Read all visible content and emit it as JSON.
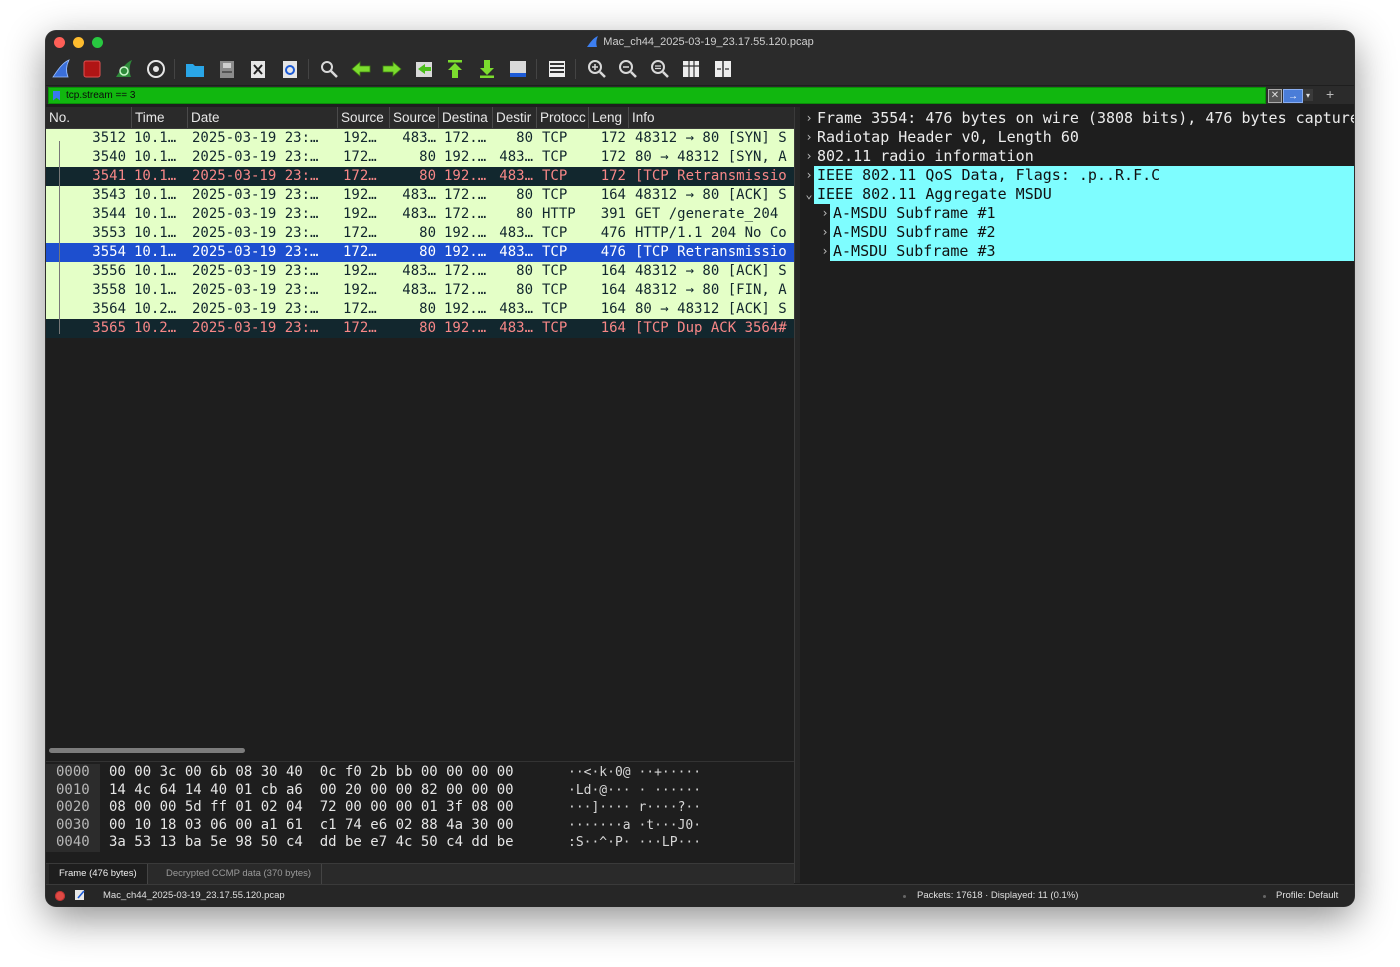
{
  "window": {
    "title": "Mac_ch44_2025-03-19_23.17.55.120.pcap",
    "colors": {
      "background": "#1e1e1e",
      "accent": "#1d4fcf"
    }
  },
  "toolbar": {
    "buttons": [
      "start-capture-icon",
      "stop-capture-icon",
      "restart-capture-icon",
      "capture-options-icon",
      "open-file-icon",
      "save-file-icon",
      "close-file-icon",
      "reload-file-icon",
      "find-packet-icon",
      "go-back-icon",
      "go-forward-icon",
      "go-to-packet-icon",
      "go-first-icon",
      "go-last-icon",
      "auto-scroll-icon",
      "colorize-icon",
      "zoom-in-icon",
      "zoom-out-icon",
      "zoom-reset-icon",
      "resize-columns-icon",
      "split-view-icon"
    ]
  },
  "filter": {
    "value": "tcp.stream == 3",
    "color": "#11b70f",
    "apply_label": "→",
    "clear_label": "✕",
    "add_label": "+"
  },
  "packet_list": {
    "columns": [
      "No.",
      "Time",
      "Date",
      "Source",
      "Source",
      "Destina",
      "Destir",
      "Protocc",
      "Leng",
      "Info"
    ],
    "rows": [
      {
        "no": "3512",
        "time": "10.1…",
        "date": "2025-03-19 23:…",
        "src": "192…",
        "sport": "483…",
        "dst": "172.…",
        "dport": "80",
        "proto": "TCP",
        "len": "172",
        "info": "48312 → 80 [SYN] S",
        "style": "green"
      },
      {
        "no": "3540",
        "time": "10.1…",
        "date": "2025-03-19 23:…",
        "src": "172…",
        "sport": "80",
        "dst": "192.…",
        "dport": "483…",
        "proto": "TCP",
        "len": "172",
        "info": "80 → 48312 [SYN, A",
        "style": "green"
      },
      {
        "no": "3541",
        "time": "10.1…",
        "date": "2025-03-19 23:…",
        "src": "172…",
        "sport": "80",
        "dst": "192.…",
        "dport": "483…",
        "proto": "TCP",
        "len": "172",
        "info": "[TCP Retransmissio",
        "style": "dark"
      },
      {
        "no": "3543",
        "time": "10.1…",
        "date": "2025-03-19 23:…",
        "src": "192…",
        "sport": "483…",
        "dst": "172.…",
        "dport": "80",
        "proto": "TCP",
        "len": "164",
        "info": "48312 → 80 [ACK] S",
        "style": "green"
      },
      {
        "no": "3544",
        "time": "10.1…",
        "date": "2025-03-19 23:…",
        "src": "192…",
        "sport": "483…",
        "dst": "172.…",
        "dport": "80",
        "proto": "HTTP",
        "len": "391",
        "info": "GET /generate_204",
        "style": "green"
      },
      {
        "no": "3553",
        "time": "10.1…",
        "date": "2025-03-19 23:…",
        "src": "172…",
        "sport": "80",
        "dst": "192.…",
        "dport": "483…",
        "proto": "TCP",
        "len": "476",
        "info": "HTTP/1.1 204 No Co",
        "style": "green"
      },
      {
        "no": "3554",
        "time": "10.1…",
        "date": "2025-03-19 23:…",
        "src": "172…",
        "sport": "80",
        "dst": "192.…",
        "dport": "483…",
        "proto": "TCP",
        "len": "476",
        "info": "[TCP Retransmissio",
        "style": "sel"
      },
      {
        "no": "3556",
        "time": "10.1…",
        "date": "2025-03-19 23:…",
        "src": "192…",
        "sport": "483…",
        "dst": "172.…",
        "dport": "80",
        "proto": "TCP",
        "len": "164",
        "info": "48312 → 80 [ACK] S",
        "style": "green"
      },
      {
        "no": "3558",
        "time": "10.1…",
        "date": "2025-03-19 23:…",
        "src": "192…",
        "sport": "483…",
        "dst": "172.…",
        "dport": "80",
        "proto": "TCP",
        "len": "164",
        "info": "48312 → 80 [FIN, A",
        "style": "green"
      },
      {
        "no": "3564",
        "time": "10.2…",
        "date": "2025-03-19 23:…",
        "src": "172…",
        "sport": "80",
        "dst": "192.…",
        "dport": "483…",
        "proto": "TCP",
        "len": "164",
        "info": "80 → 48312 [ACK] S",
        "style": "green"
      },
      {
        "no": "3565",
        "time": "10.2…",
        "date": "2025-03-19 23:…",
        "src": "172…",
        "sport": "80",
        "dst": "192.…",
        "dport": "483…",
        "proto": "TCP",
        "len": "164",
        "info": "[TCP Dup ACK 3564#",
        "style": "dark"
      }
    ]
  },
  "details": {
    "items": [
      {
        "text": "Frame 3554: 476 bytes on wire (3808 bits), 476 bytes captured",
        "expanded": false,
        "level": 0,
        "highlight": false
      },
      {
        "text": "Radiotap Header v0, Length 60",
        "expanded": false,
        "level": 0,
        "highlight": false
      },
      {
        "text": "802.11 radio information",
        "expanded": false,
        "level": 0,
        "highlight": false
      },
      {
        "text": "IEEE 802.11 QoS Data, Flags: .p..R.F.C",
        "expanded": false,
        "level": 0,
        "highlight": true
      },
      {
        "text": "IEEE 802.11 Aggregate MSDU",
        "expanded": true,
        "level": 0,
        "highlight": true
      },
      {
        "text": "A-MSDU Subframe #1",
        "expanded": false,
        "level": 1,
        "highlight": true
      },
      {
        "text": "A-MSDU Subframe #2",
        "expanded": false,
        "level": 1,
        "highlight": true
      },
      {
        "text": "A-MSDU Subframe #3",
        "expanded": false,
        "level": 1,
        "highlight": true
      }
    ],
    "highlight_color": "#7efdff"
  },
  "hex": {
    "rows": [
      {
        "offset": "0000",
        "bytes": "00 00 3c 00 6b 08 30 40  0c f0 2b bb 00 00 00 00",
        "ascii": "··<·k·0@ ··+·····"
      },
      {
        "offset": "0010",
        "bytes": "14 4c 64 14 40 01 cb a6  00 20 00 00 82 00 00 00",
        "ascii": "·Ld·@··· · ······"
      },
      {
        "offset": "0020",
        "bytes": "08 00 00 5d ff 01 02 04  72 00 00 00 01 3f 08 00",
        "ascii": "···]···· r····?··"
      },
      {
        "offset": "0030",
        "bytes": "00 10 18 03 06 00 a1 61  c1 74 e6 02 88 4a 30 00",
        "ascii": "·······a ·t···J0·"
      },
      {
        "offset": "0040",
        "bytes": "3a 53 13 ba 5e 98 50 c4  dd be e7 4c 50 c4 dd be",
        "ascii": ":S··^·P· ···LP···"
      }
    ],
    "tabs": [
      "Frame (476 bytes)",
      "Decrypted CCMP data (370 bytes)"
    ]
  },
  "statusbar": {
    "file": "Mac_ch44_2025-03-19_23.17.55.120.pcap",
    "packets": "Packets: 17618 · Displayed: 11 (0.1%)",
    "profile": "Profile: Default"
  }
}
